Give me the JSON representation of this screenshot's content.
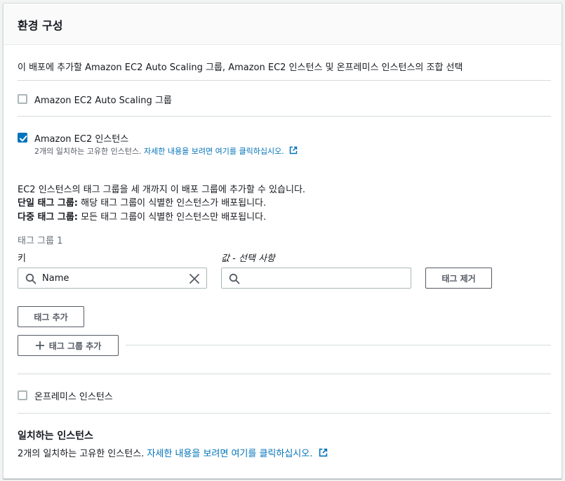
{
  "section": {
    "title": "환경 구성",
    "description": "이 배포에 추가할 Amazon EC2 Auto Scaling 그룹, Amazon EC2 인스턴스 및 온프레미스 인스턴스의 조합 선택"
  },
  "options": {
    "auto_scaling": {
      "label": "Amazon EC2 Auto Scaling 그룹",
      "checked": false
    },
    "ec2": {
      "label": "Amazon EC2 인스턴스",
      "checked": true,
      "match_text": "2개의 일치하는 고유한 인스턴스.",
      "link_text": "자세한 내용을 보려면 여기를 클릭하십시오."
    },
    "onprem": {
      "label": "온프레미스 인스턴스",
      "checked": false
    }
  },
  "tag_info": {
    "line1": "EC2 인스턴스의 태그 그룹을 세 개까지 이 배포 그룹에 추가할 수 있습니다.",
    "single_label": "단일 태그 그룹:",
    "single_text": " 해당 태그 그룹이 식별한 인스턴스가 배포됩니다.",
    "multi_label": "다중 태그 그룹:",
    "multi_text": " 모든 태그 그룹이 식별한 인스턴스만 배포됩니다."
  },
  "tag_group": {
    "title": "태그 그룹 1",
    "key_label": "키",
    "value_label": "값 - 선택 사항",
    "key_value": "Name",
    "value_value": "",
    "remove_button": "태그 제거",
    "add_tag_button": "태그 추가",
    "add_group_button": "태그 그룹 추가"
  },
  "matching": {
    "title": "일치하는 인스턴스",
    "text": "2개의 일치하는 고유한 인스턴스.",
    "link_text": "자세한 내용을 보려면 여기를 클릭하십시오."
  },
  "colors": {
    "accent": "#0073bb",
    "border": "#aab7b8",
    "text": "#16191f"
  },
  "icons": [
    "checkmark-icon",
    "external-link-icon",
    "search-icon",
    "clear-icon",
    "plus-icon"
  ]
}
